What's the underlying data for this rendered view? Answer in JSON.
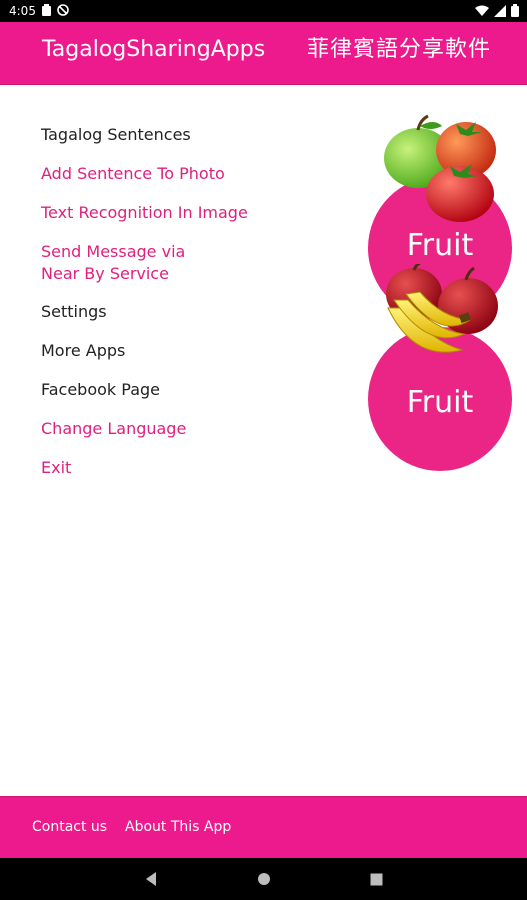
{
  "status_bar": {
    "time": "4:05",
    "left_icons": [
      "notification-icon",
      "blocked-icon"
    ],
    "right_icons": [
      "wifi-icon",
      "cell-signal-icon",
      "battery-icon"
    ]
  },
  "header": {
    "title": "TagalogSharingApps",
    "subtitle": "菲律賓語分享軟件",
    "background_color": "#ec1a8c"
  },
  "menu": {
    "items": [
      {
        "label": "Tagalog Sentences",
        "color": "dark"
      },
      {
        "label": "Add Sentence To Photo",
        "color": "pink"
      },
      {
        "label": "Text Recognition In Image",
        "color": "pink"
      },
      {
        "label": "Send Message via",
        "line2": "Near By Service",
        "color": "pink"
      },
      {
        "label": "Settings",
        "color": "dark"
      },
      {
        "label": "More Apps",
        "color": "dark"
      },
      {
        "label": "Facebook Page",
        "color": "dark"
      },
      {
        "label": "Change Language",
        "color": "pink"
      },
      {
        "label": "Exit",
        "color": "pink"
      }
    ]
  },
  "fruit_buttons": [
    {
      "label": "Fruit",
      "art": "apples-tomatoes-icon"
    },
    {
      "label": "Fruit",
      "art": "apples-bananas-icon"
    }
  ],
  "footer": {
    "links": [
      "Contact us",
      "About This App"
    ],
    "background_color": "#ec1a8c"
  },
  "nav_bar": {
    "buttons": [
      "back-icon",
      "home-icon",
      "recents-icon"
    ]
  }
}
